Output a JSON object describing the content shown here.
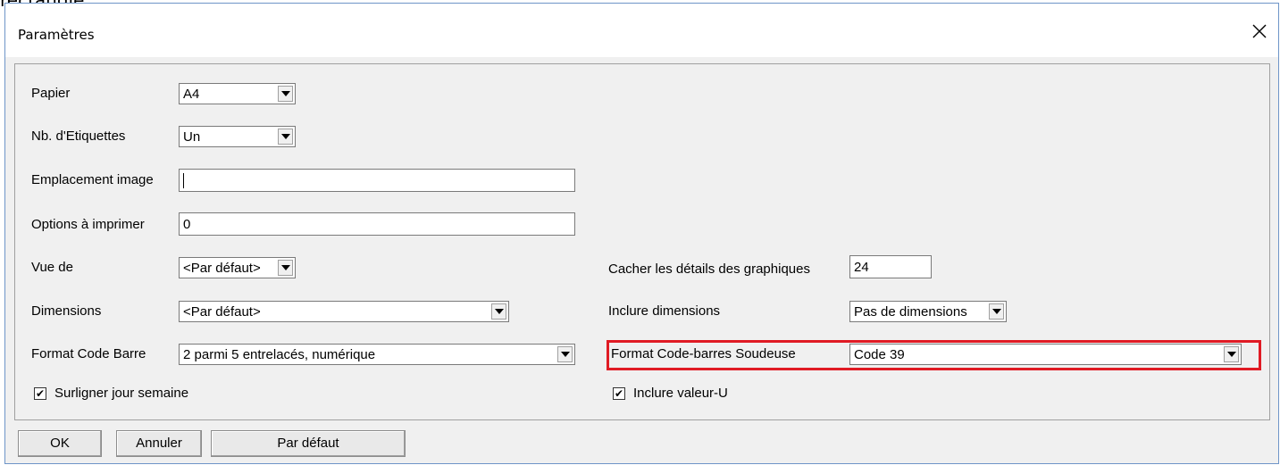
{
  "page_fragment_text": "rectangle.",
  "dialog": {
    "title": "Paramètres",
    "close_icon": "close-icon"
  },
  "fields": {
    "papier": {
      "label": "Papier",
      "value": "A4"
    },
    "nb_etiquettes": {
      "label": "Nb. d'Etiquettes",
      "value": "Un"
    },
    "emplacement_image": {
      "label": "Emplacement image",
      "value": ""
    },
    "options_imprimer": {
      "label": "Options à imprimer",
      "value": "0"
    },
    "vue_de": {
      "label": "Vue de",
      "value": "<Par défaut>"
    },
    "dimensions": {
      "label": "Dimensions",
      "value": "<Par défaut>"
    },
    "format_code_barre": {
      "label": "Format Code Barre",
      "value": "2 parmi 5 entrelacés, numérique"
    },
    "surligner": {
      "label": "Surligner jour semaine",
      "checked": true
    },
    "cacher_details": {
      "label": "Cacher les détails des graphiques",
      "value": "24"
    },
    "inclure_dimensions": {
      "label": "Inclure dimensions",
      "value": "Pas de dimensions"
    },
    "format_soudeuse": {
      "label": "Format Code-barres Soudeuse",
      "value": "Code 39"
    },
    "inclure_valeur_u": {
      "label": "Inclure valeur-U",
      "checked": true
    }
  },
  "buttons": {
    "ok": "OK",
    "annuler": "Annuler",
    "par_defaut": "Par défaut"
  },
  "colors": {
    "highlight": "#e01b24",
    "dialog_border": "#6e95c8",
    "panel_bg": "#f0f0f0"
  }
}
